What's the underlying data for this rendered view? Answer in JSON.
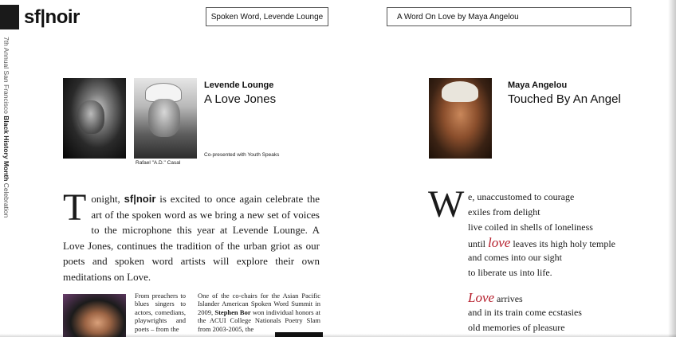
{
  "header": {
    "logo": "sf|noir",
    "side_caption_prefix": "7th Annual San Francisco ",
    "side_caption_bold": "Black History Month",
    "side_caption_suffix": " Celebration"
  },
  "tabs": [
    {
      "label": "Spoken Word, Levende Lounge"
    },
    {
      "label": "A Word On Love by Maya Angelou"
    }
  ],
  "left_article": {
    "venue": "Levende Lounge",
    "title": "A Love Jones",
    "photo_caption": "Rafael \"A.D.\" Casal",
    "copresented": "Co-presented with Youth Speaks",
    "intro_dropcap": "T",
    "intro_1": "onight, ",
    "intro_brand": "sf|noir",
    "intro_2": " is excited to once again celebrate the art of the spoken word as we bring a new set of voices to the microphone this year at Levende Lounge. A Love Jones, continues the tradition of the urban griot as our poets and spoken word artists will explore their own meditations on Love.",
    "col_a": "From preachers to blues singers to actors, comedians, playwrights and poets – from the",
    "col_b_1": "One of the co-chairs for the Asian Pacific Islander American Spoken Word Summit in 2009, ",
    "col_b_name": "Stephen Bor",
    "col_b_2": " won individual honors at the ACUI College Nationals Poetry Slam from 2003-2005, the"
  },
  "right_article": {
    "name": "Maya Angelou",
    "title": "Touched By An Angel",
    "poem_dropcap": "W",
    "poem_line1": "e, unaccustomed to courage",
    "poem_line2": "exiles from delight",
    "poem_line3": "live coiled in shells of loneliness",
    "poem_line4_pre": "until ",
    "poem_line4_love": "love",
    "poem_line4_post": " leaves its high holy temple",
    "poem_line5": "and comes into our sight",
    "poem_line6": "to liberate us into life.",
    "poem_line7_love": "Love",
    "poem_line7_post": " arrives",
    "poem_line8": "and in its train come ecstasies",
    "poem_line9": "old memories of pleasure"
  },
  "colors": {
    "accent_red": "#b51c2a",
    "logo_block": "#1a1a1a"
  }
}
